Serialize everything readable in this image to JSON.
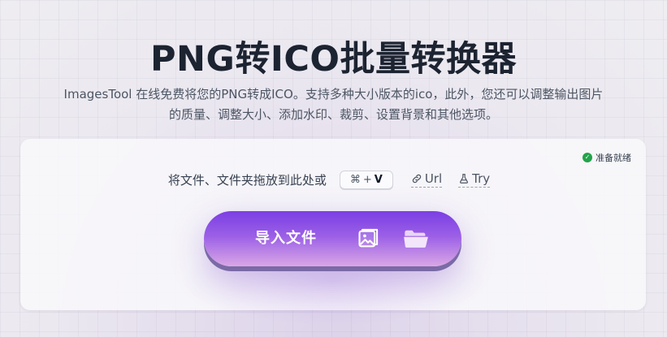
{
  "page": {
    "title": "PNG转ICO批量转换器",
    "description_line1": "ImagesTool 在线免费将您的PNG转成ICO。支持多种大小版本的ico，此外，您还可以调整输出图片",
    "description_line2": "的质量、调整大小、添加水印、裁剪、设置背景和其他选项。"
  },
  "card": {
    "status": "准备就绪",
    "drop_text": "将文件、文件夹拖放到此处或",
    "shortcut": {
      "symbol": "⌘",
      "plus": "+",
      "key": "V"
    },
    "url_label": "Url",
    "try_label": "Try",
    "import_label": "导入文件"
  },
  "icons": {
    "status": "check-circle-icon",
    "url": "link-icon",
    "try": "flask-icon",
    "image": "image-icon",
    "folder": "folder-icon"
  },
  "colors": {
    "button_top": "#7b3fe4",
    "button_bottom": "#d9a7e6",
    "status_green": "#22a34a"
  }
}
